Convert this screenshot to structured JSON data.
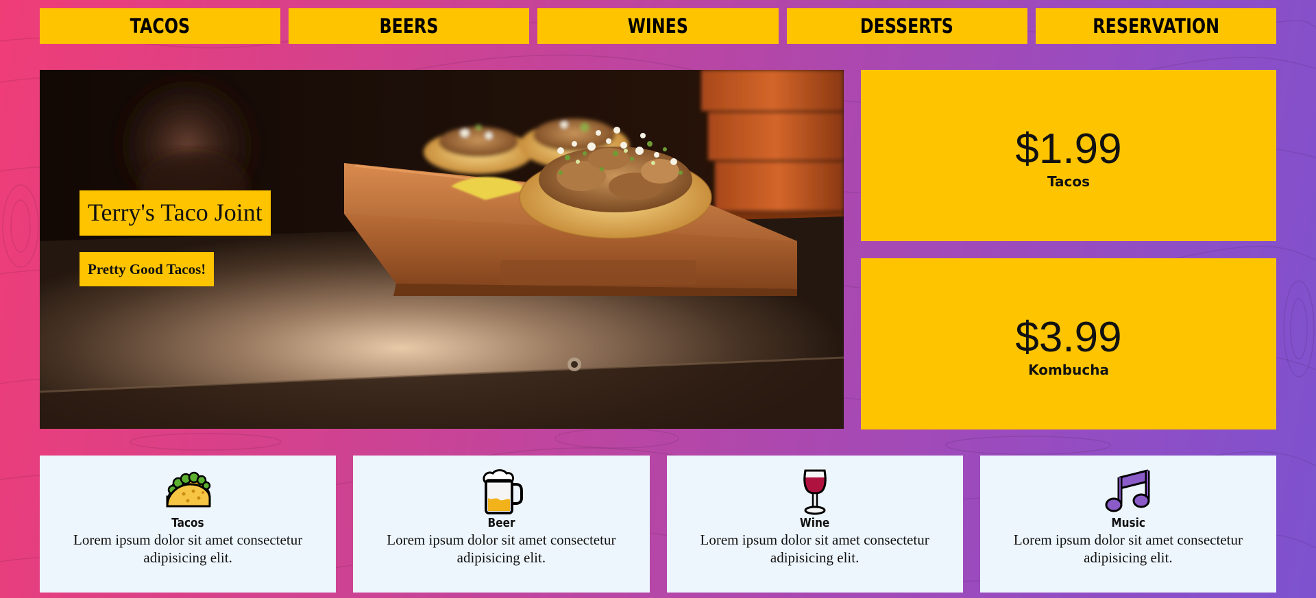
{
  "nav": {
    "items": [
      {
        "label": "TACOS"
      },
      {
        "label": "BEERS"
      },
      {
        "label": "WINES"
      },
      {
        "label": "DESSERTS"
      },
      {
        "label": "RESERVATION"
      }
    ]
  },
  "hero": {
    "title": "Terry's Taco Joint",
    "subtitle": "Pretty Good Tacos!"
  },
  "prices": [
    {
      "value": "$1.99",
      "label": "Tacos"
    },
    {
      "value": "$3.99",
      "label": "Kombucha"
    }
  ],
  "features": [
    {
      "icon": "taco-icon",
      "title": "Tacos",
      "description": "Lorem ipsum dolor sit amet consectetur adipisicing elit."
    },
    {
      "icon": "beer-icon",
      "title": "Beer",
      "description": "Lorem ipsum dolor sit amet consectetur adipisicing elit."
    },
    {
      "icon": "wine-icon",
      "title": "Wine",
      "description": "Lorem ipsum dolor sit amet consectetur adipisicing elit."
    },
    {
      "icon": "music-icon",
      "title": "Music",
      "description": "Lorem ipsum dolor sit amet consectetur adipisicing elit."
    }
  ],
  "colors": {
    "accent": "#ffc400",
    "card_background": "#eef6fd",
    "gradient_start": "#ef3d77",
    "gradient_end": "#7d52cf"
  }
}
